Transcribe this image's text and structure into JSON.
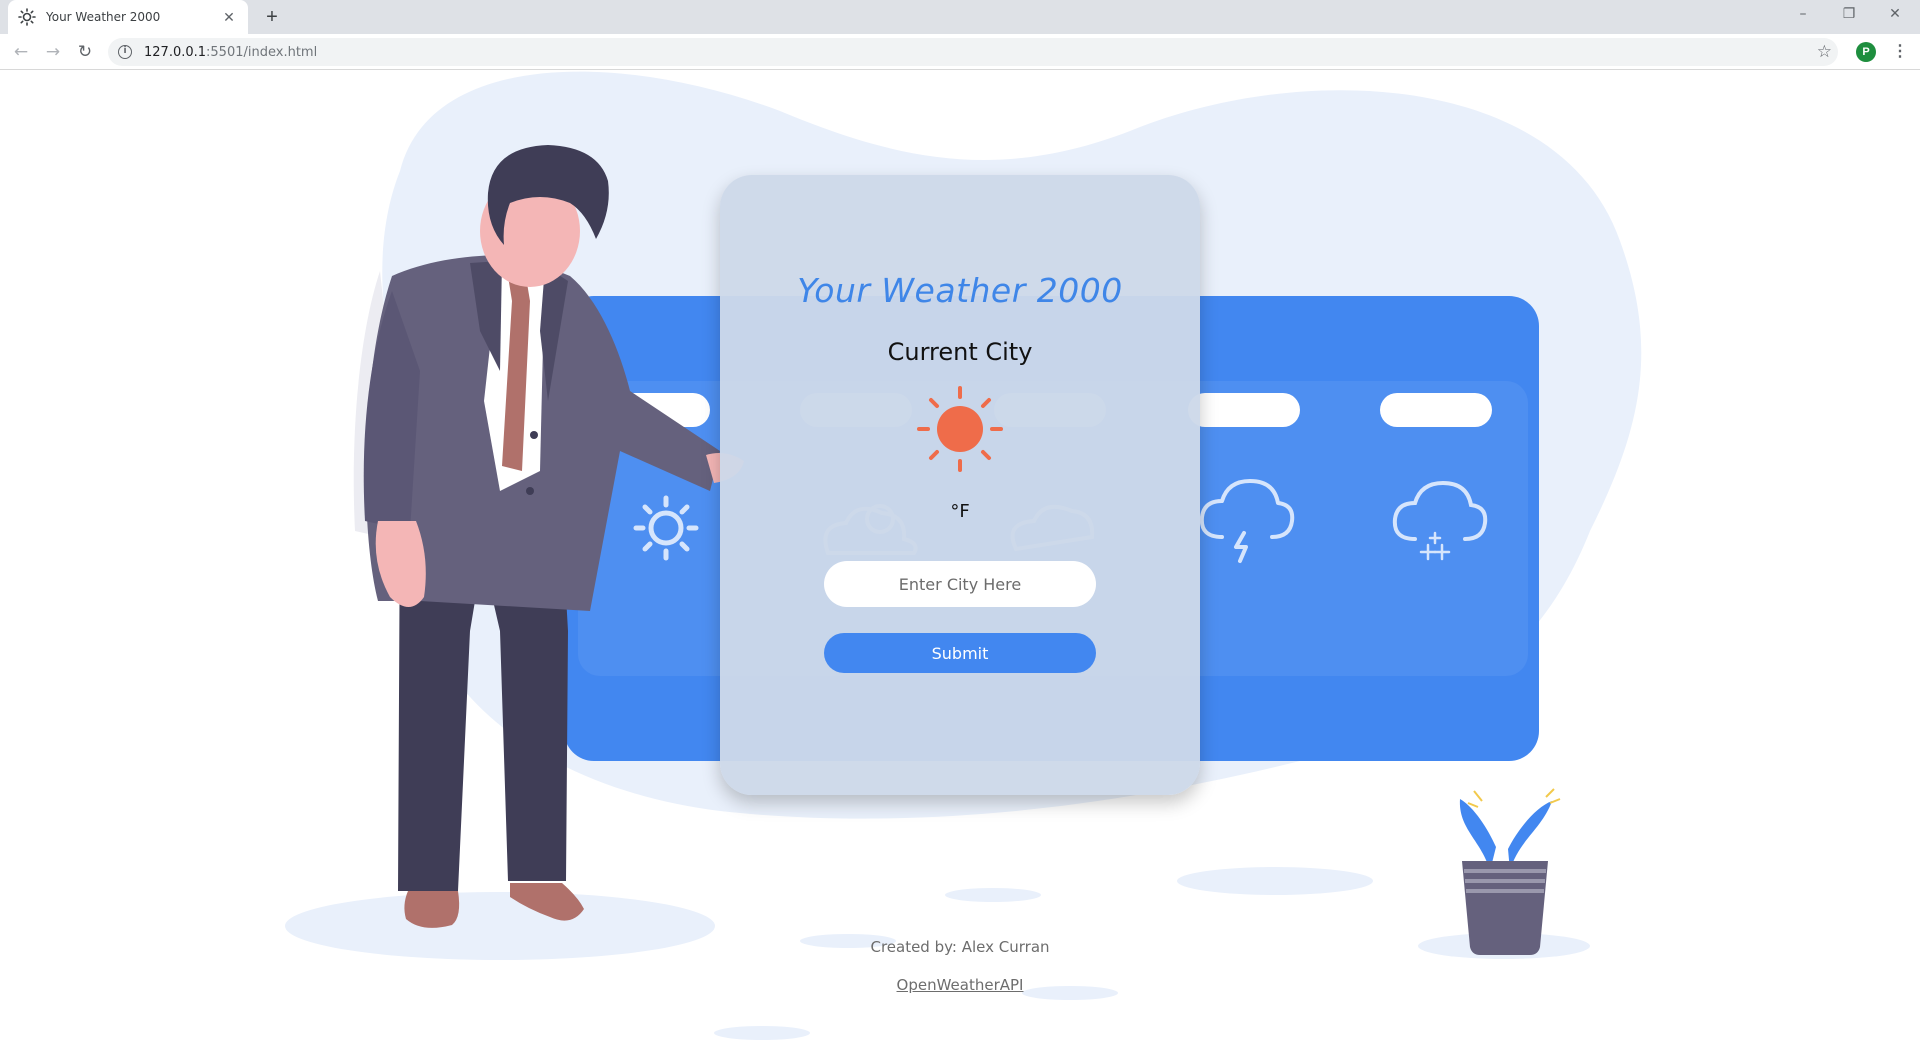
{
  "browser": {
    "tab_title": "Your Weather 2000",
    "new_tab_label": "+",
    "url_host": "127.0.0.1",
    "url_path": ":5501/index.html",
    "profile_initial": "P",
    "window_controls": {
      "minimize": "–",
      "restore": "❐",
      "close": "✕"
    },
    "back": "←",
    "forward": "→",
    "reload": "↻",
    "star": "☆",
    "menu": "⋮",
    "tab_close": "✕"
  },
  "app": {
    "title": "Your Weather 2000",
    "city": "Current City",
    "temperature": "°F",
    "weather_icon": "sun-icon",
    "input_placeholder": "Enter City Here",
    "input_value": "",
    "submit_label": "Submit"
  },
  "footer": {
    "credit": "Created by: Alex Curran",
    "api_link": "OpenWeatherAPI"
  },
  "colors": {
    "accent_blue": "#4287f0",
    "title_blue": "#3f86e8",
    "sun_orange": "#ef6c4a",
    "card_bg": "#cdd9e9",
    "blob_bg": "#e9f0fb",
    "suit": "#65617d",
    "pants": "#3f3d56",
    "skin": "#f4b6b6",
    "tie": "#b0716b"
  },
  "background_icons": [
    "sun-icon",
    "partly-cloudy-icon",
    "cloud-icon",
    "thunderstorm-icon",
    "snow-icon"
  ]
}
